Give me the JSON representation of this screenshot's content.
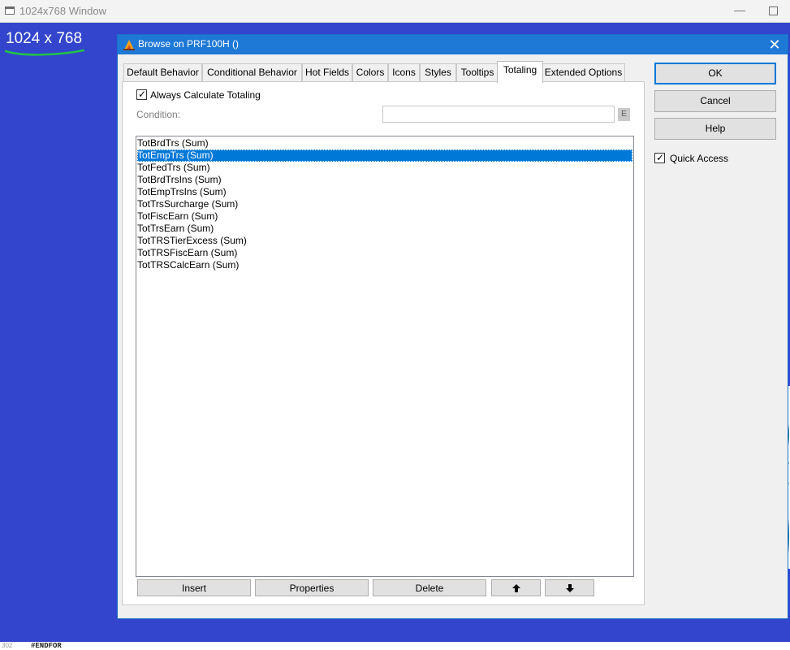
{
  "outer_window": {
    "title": "1024x768 Window",
    "minimize_glyph": "—"
  },
  "desktop": {
    "resolution_label": "1024 x 768",
    "background_color": "#3245cc",
    "underline_color": "#22c24a"
  },
  "dialog": {
    "title": "Browse on PRF100H ()",
    "close_glyph": "✕",
    "tabs": [
      {
        "label": "Default Behavior",
        "active": false
      },
      {
        "label": "Conditional Behavior",
        "active": false
      },
      {
        "label": "Hot Fields",
        "active": false
      },
      {
        "label": "Colors",
        "active": false
      },
      {
        "label": "Icons",
        "active": false
      },
      {
        "label": "Styles",
        "active": false
      },
      {
        "label": "Tooltips",
        "active": false
      },
      {
        "label": "Totaling",
        "active": true
      },
      {
        "label": "Extended Options",
        "active": false
      }
    ],
    "totaling": {
      "always_calculate_label": "Always Calculate Totaling",
      "always_calculate_checked": true,
      "condition_label": "Condition:",
      "condition_value": "",
      "expression_button": "E",
      "list_items": [
        {
          "label": "TotBrdTrs (Sum)",
          "selected": false
        },
        {
          "label": "TotEmpTrs (Sum)",
          "selected": true
        },
        {
          "label": "TotFedTrs (Sum)",
          "selected": false
        },
        {
          "label": "TotBrdTrsIns (Sum)",
          "selected": false
        },
        {
          "label": "TotEmpTrsIns (Sum)",
          "selected": false
        },
        {
          "label": "TotTrsSurcharge (Sum)",
          "selected": false
        },
        {
          "label": "TotFiscEarn (Sum)",
          "selected": false
        },
        {
          "label": "TotTrsEarn (Sum)",
          "selected": false
        },
        {
          "label": "TotTRSTierExcess (Sum)",
          "selected": false
        },
        {
          "label": "TotTRSFiscEarn (Sum)",
          "selected": false
        },
        {
          "label": "TotTRSCalcEarn (Sum)",
          "selected": false
        }
      ],
      "buttons": {
        "insert": "Insert",
        "properties": "Properties",
        "delete": "Delete",
        "move_up_icon": "arrow-up-icon",
        "move_down_icon": "arrow-down-icon"
      }
    },
    "side_buttons": {
      "ok": "OK",
      "cancel": "Cancel",
      "help": "Help"
    },
    "quick_access_label": "Quick Access",
    "quick_access_checked": true,
    "accent_color": "#0078d7",
    "titlebar_color": "#1e78d6"
  },
  "background_code": {
    "line_number": "302",
    "text": "#ENDFOR"
  }
}
